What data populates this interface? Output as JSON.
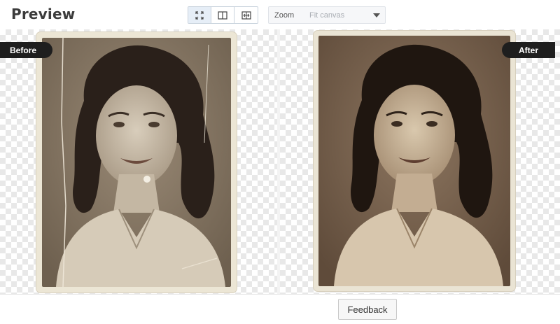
{
  "header": {
    "title": "Preview",
    "view_modes": [
      {
        "name": "fit-screen-icon",
        "active": true
      },
      {
        "name": "split-view-icon",
        "active": false
      },
      {
        "name": "side-by-side-icon",
        "active": false
      }
    ],
    "zoom": {
      "label": "Zoom",
      "value": "Fit canvas"
    }
  },
  "preview": {
    "before_label": "Before",
    "after_label": "After"
  },
  "footer": {
    "feedback_label": "Feedback"
  },
  "colors": {
    "badge_bg": "#1e1e1e",
    "active_toggle_bg": "#e6eef7",
    "sepia_before": "#8c7b66",
    "sepia_after": "#7a614b"
  }
}
